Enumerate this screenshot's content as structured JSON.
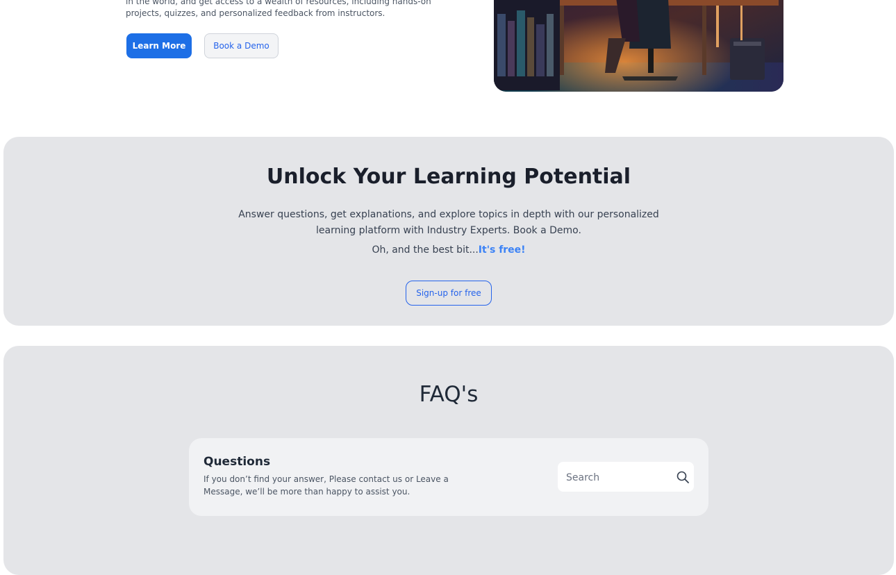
{
  "hero": {
    "text_line1": "in the world, and get access to a wealth of resources, including hands-on",
    "text_line2": "projects, quizzes, and personalized feedback from instructors.",
    "learn_more_label": "Learn More",
    "book_demo_label": "Book a Demo",
    "image_alt": "person-at-desk-photo"
  },
  "cta": {
    "title": "Unlock Your Learning Potential",
    "description": "Answer questions, get explanations, and explore topics in depth with our personalized learning platform with Industry Experts. Book a Demo.",
    "free_prefix": "Oh, and the best bit...",
    "free_highlight": "It's free!",
    "signup_label": "Sign-up for free"
  },
  "faq": {
    "title": "FAQ's",
    "card_title": "Questions",
    "card_description": "If you don’t find your answer, Please contact us or Leave a Message, we’ll be more than happy to assist you.",
    "search_placeholder": "Search"
  },
  "colors": {
    "primary": "#1d6fe6",
    "link": "#2563eb",
    "highlight": "#3b82f6",
    "panel_bg": "#e4e5e8",
    "card_bg": "#f1f2f4"
  },
  "icons": {
    "search": "search-icon"
  }
}
